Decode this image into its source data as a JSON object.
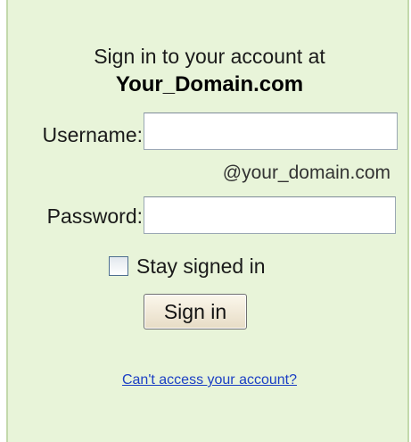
{
  "login": {
    "heading": "Sign in to your account at",
    "domain": "Your_Domain.com",
    "username_label": "Username:",
    "username_value": "",
    "domain_hint": "@your_domain.com",
    "password_label": "Password:",
    "password_value": "",
    "stay_signed_in_label": "Stay signed in",
    "stay_signed_in_checked": false,
    "sign_in_button": "Sign in",
    "help_link": "Can't access your account?"
  },
  "colors": {
    "panel_background": "#e8f4d9",
    "panel_border": "#c3d9ac",
    "link": "#1b3fc4"
  }
}
